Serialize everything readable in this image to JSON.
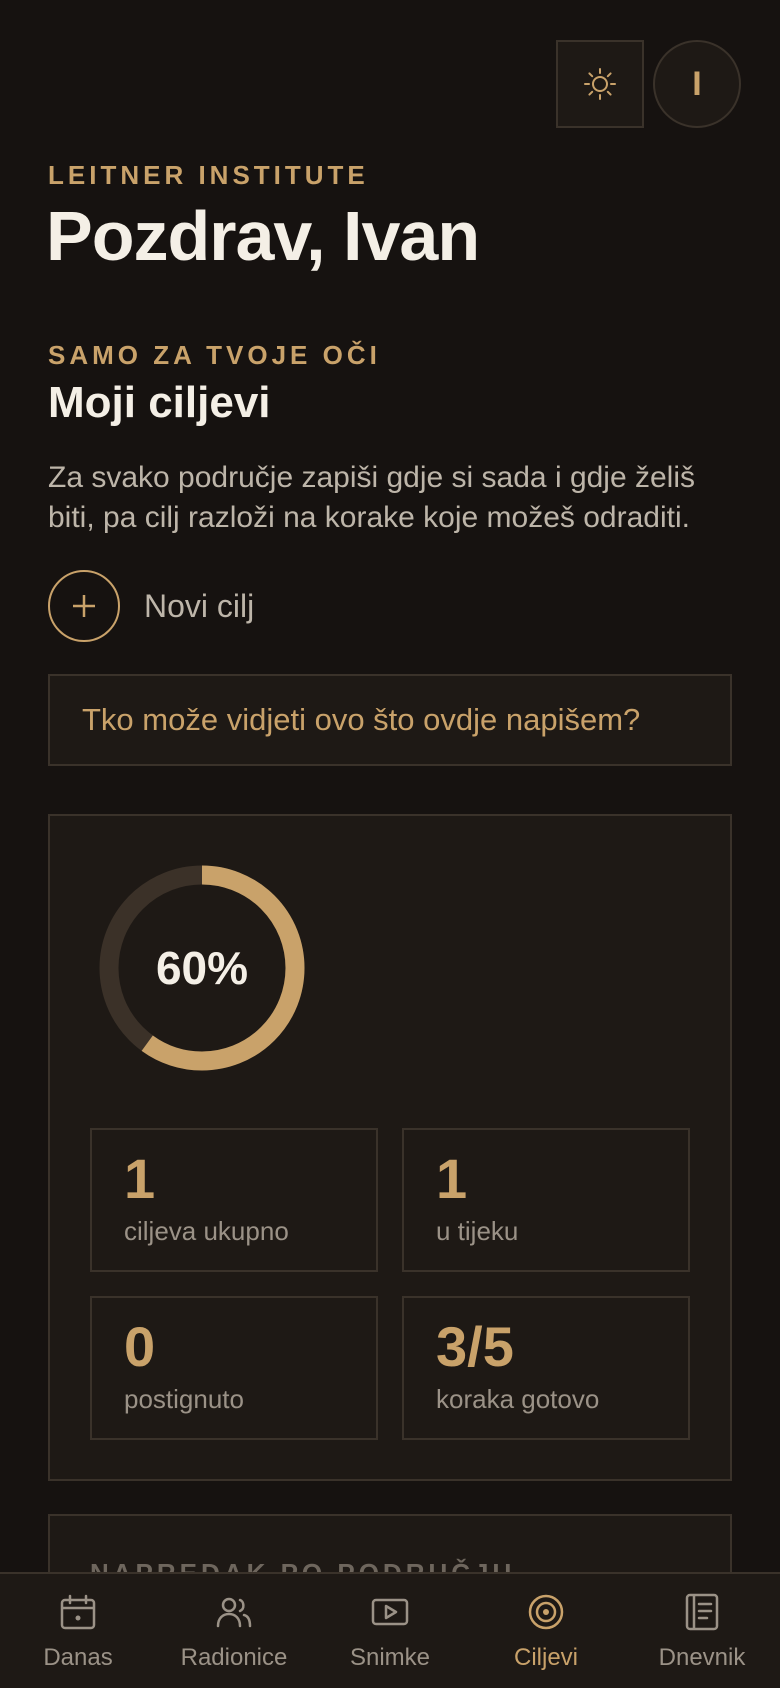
{
  "header": {
    "theme_icon": "sun-icon",
    "avatar_initial": "I",
    "org_name": "LEITNER INSTITUTE",
    "greeting": "Pozdrav, Ivan"
  },
  "goals_section": {
    "eyebrow": "SAMO ZA TVOJE OČI",
    "title": "Moji ciljevi",
    "description": "Za svako područje zapiši gdje si sada i gdje želiš biti, pa cilj razloži na korake koje možeš odraditi.",
    "new_goal_label": "Novi cilj",
    "privacy_question": "Tko može vidjeti ovo što ovdje napišem?"
  },
  "stats": {
    "progress_percent": 60,
    "progress_label": "60%",
    "tiles": [
      {
        "value": "1",
        "label": "ciljeva ukupno"
      },
      {
        "value": "1",
        "label": "u tijeku"
      },
      {
        "value": "0",
        "label": "postignuto"
      },
      {
        "value": "3/5",
        "label": "koraka gotovo"
      }
    ]
  },
  "progress_by_area": {
    "title": "NAPREDAK PO PODRUČJU"
  },
  "bottom_nav": {
    "items": [
      {
        "label": "Danas",
        "icon": "calendar-icon",
        "active": false
      },
      {
        "label": "Radionice",
        "icon": "users-icon",
        "active": false
      },
      {
        "label": "Snimke",
        "icon": "video-icon",
        "active": false
      },
      {
        "label": "Ciljevi",
        "icon": "target-icon",
        "active": true
      },
      {
        "label": "Dnevnik",
        "icon": "journal-icon",
        "active": false
      }
    ]
  },
  "colors": {
    "background": "#161210",
    "surface": "#1e1915",
    "border": "#3a322a",
    "accent": "#c9a26a",
    "text_primary": "#f4efe6",
    "text_secondary": "#bdb5a9",
    "ring_track": "#3b3128"
  }
}
